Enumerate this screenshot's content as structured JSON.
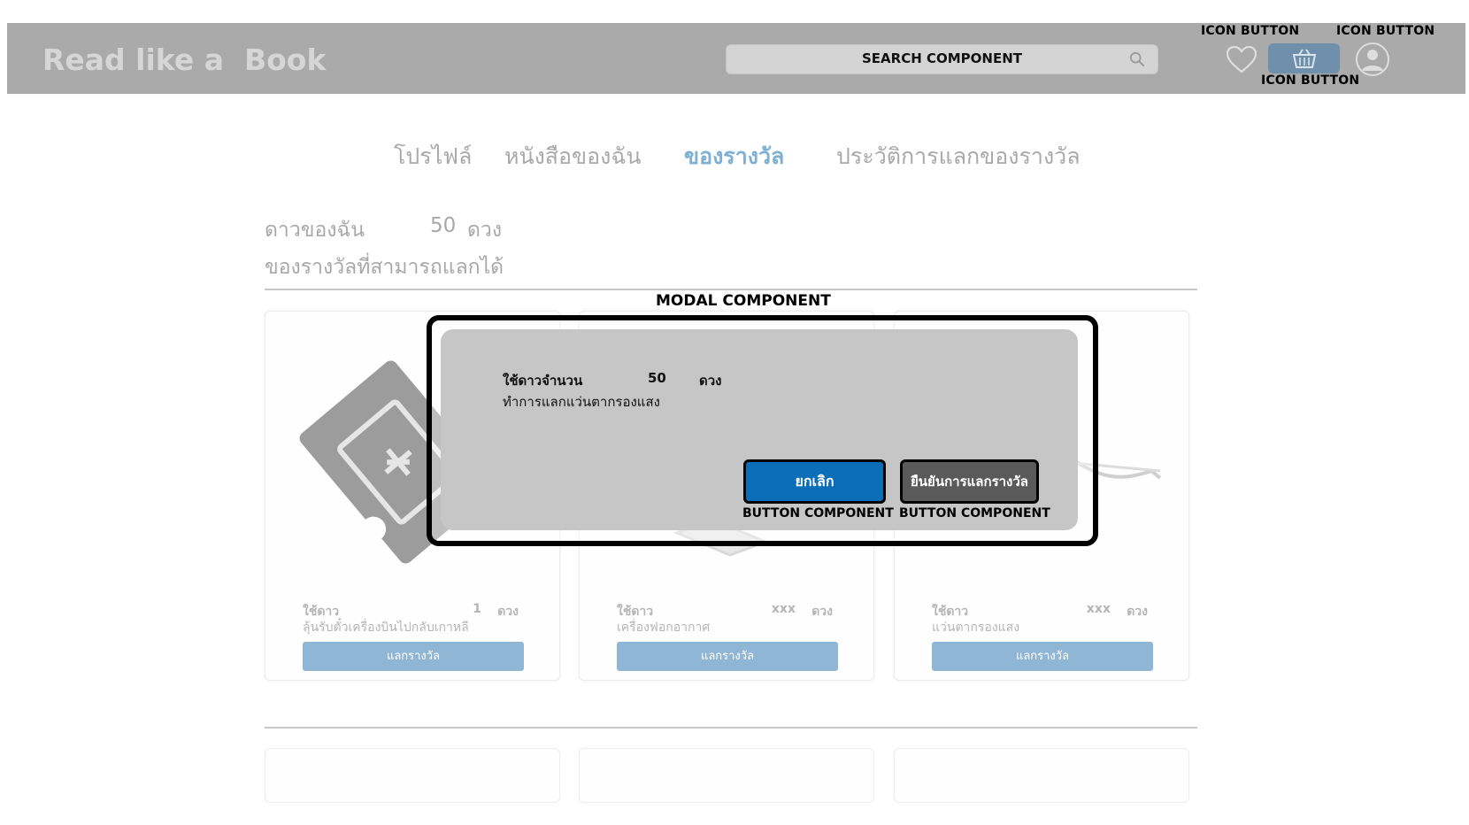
{
  "header": {
    "brand": "Read like a  Book",
    "search_placeholder": "SEARCH COMPONENT",
    "icons": [
      "heart-icon",
      "basket-icon",
      "user-icon"
    ],
    "annotations": {
      "icon_button_left": "ICON BUTTON",
      "icon_button_right": "ICON BUTTON",
      "icon_button_center": "ICON BUTTON"
    }
  },
  "tabs": [
    {
      "label": "โปรไฟล์",
      "active": false
    },
    {
      "label": "หนังสือของฉัน",
      "active": false
    },
    {
      "label": "ของรางวัล",
      "active": true
    },
    {
      "label": "ประวัติการแลกของรางวัล",
      "active": false
    }
  ],
  "stars": {
    "label": "ดาวของฉัน",
    "count": "50",
    "unit": "ดวง"
  },
  "rewards_title": "ของรางวัลที่สามารถแลกได้",
  "cards": [
    {
      "use_label": "ใช้ดาว",
      "qty": "1",
      "unit": "ดวง",
      "name": "ลุ้นรับตั๋วเครื่องบินไปกลับเกาหลี",
      "button": "แลกรางวัล",
      "image_icon": "ticket-icon"
    },
    {
      "use_label": "ใช้ดาว",
      "qty": "xxx",
      "unit": "ดวง",
      "name": "เครื่องฟอกอากาศ",
      "button": "แลกรางวัล",
      "image_icon": "air-purifier-icon"
    },
    {
      "use_label": "ใช้ดาว",
      "qty": "xxx",
      "unit": "ดวง",
      "name": "แว่นตากรองแสง",
      "button": "แลกรางวัล",
      "image_icon": "glasses-icon"
    }
  ],
  "modal": {
    "annotation": "MODAL COMPONENT",
    "use_label": "ใช้ดาวจำนวน",
    "qty": "50",
    "unit": "ดวง",
    "description": "ทำการแลกแว่นตากรองแสง",
    "cancel_label": "ยกเลิก",
    "confirm_label": "ยืนยันการแลกรางวัล",
    "button_annotation": "BUTTON COMPONENT",
    "cancel_color": "#0a6eb8"
  },
  "colors": {
    "header_bg": "#aaaaaa",
    "accent": "#7fb0d4",
    "redeem_button": "#8fb6d4"
  }
}
